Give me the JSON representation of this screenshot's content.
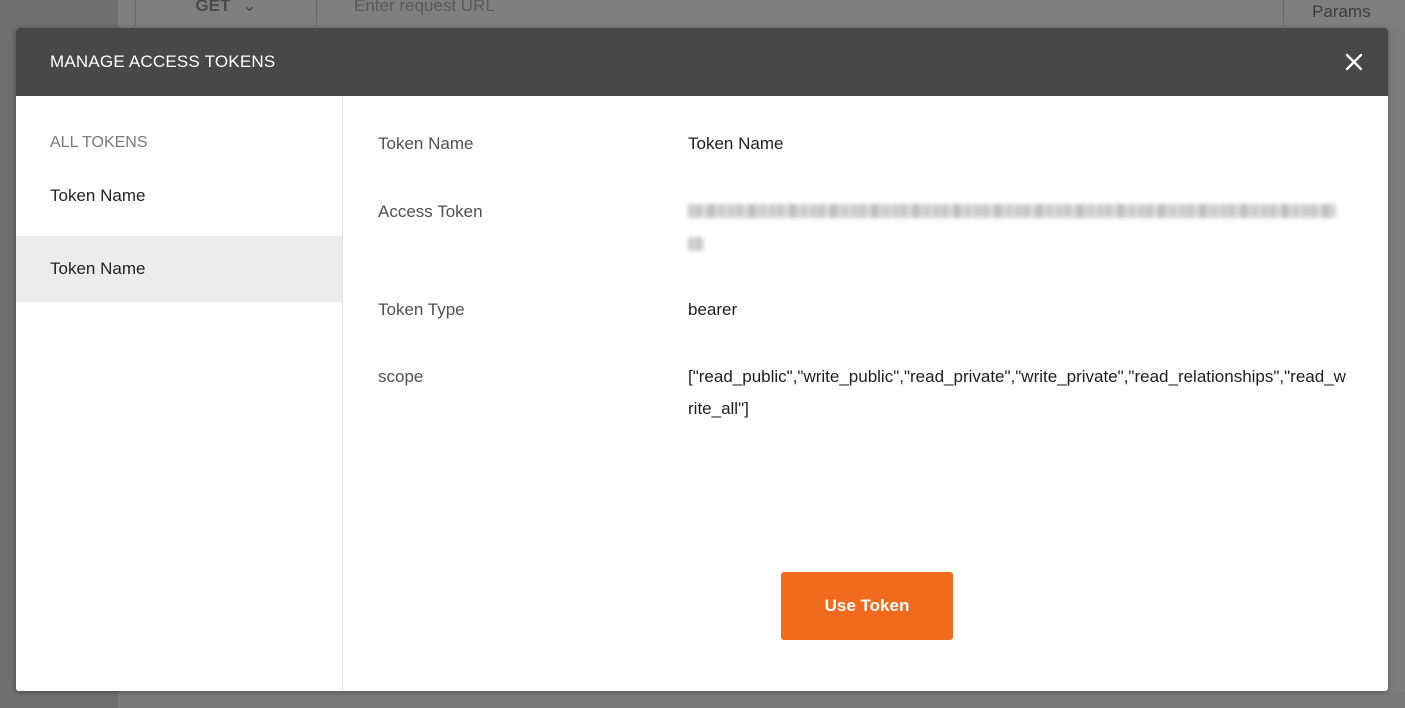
{
  "background": {
    "method_label": "GET",
    "url_placeholder": "Enter request URL",
    "params_label": "Params"
  },
  "modal": {
    "title": "MANAGE ACCESS TOKENS",
    "close_icon": "close-icon"
  },
  "sidebar": {
    "heading": "ALL TOKENS",
    "items": [
      {
        "label": "Token Name",
        "selected": false
      },
      {
        "label": "Token Name",
        "selected": true
      }
    ]
  },
  "detail": {
    "fields": [
      {
        "label": "Token Name",
        "value": "Token Name"
      },
      {
        "label": "Access Token",
        "value": ""
      },
      {
        "label": "Token Type",
        "value": "bearer"
      },
      {
        "label": "scope",
        "value": "[\"read_public\",\"write_public\",\"read_private\",\"write_private\",\"read_relationships\",\"read_write_all\"]"
      }
    ],
    "use_token_label": "Use Token"
  },
  "colors": {
    "header_bg": "#484848",
    "accent": "#f26b1d",
    "selected_item_bg": "#ececec"
  }
}
